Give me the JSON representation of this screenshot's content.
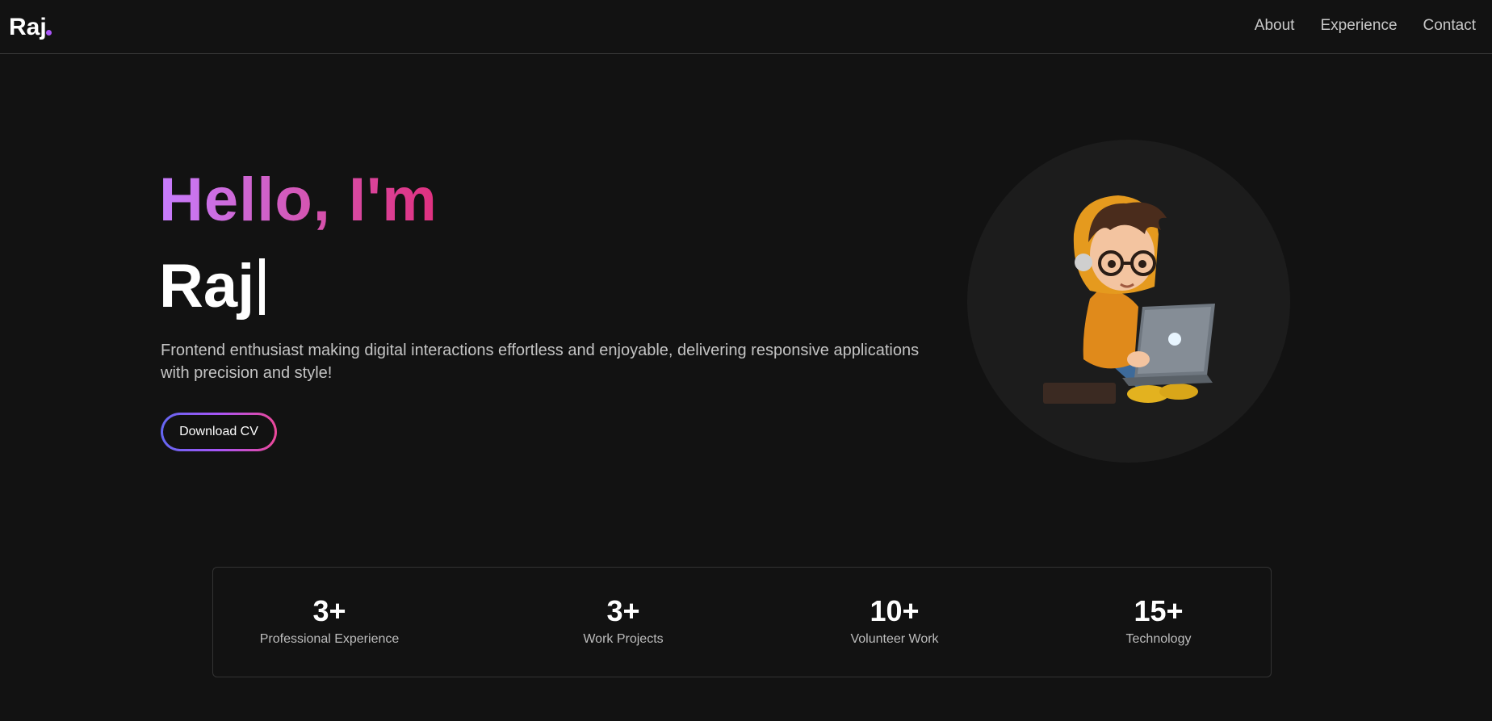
{
  "nav": {
    "logo": "Raj",
    "links": [
      "About",
      "Experience",
      "Contact"
    ]
  },
  "hero": {
    "greeting": "Hello, I'm",
    "name": "Raj",
    "tagline": "Frontend enthusiast making digital interactions effortless and enjoyable, delivering responsive applications with precision and style!",
    "cta_label": "Download CV"
  },
  "stats": [
    {
      "value": "3+",
      "label": "Professional Experience"
    },
    {
      "value": "3+",
      "label": "Work Projects"
    },
    {
      "value": "10+",
      "label": "Volunteer Work"
    },
    {
      "value": "15+",
      "label": "Technology"
    }
  ],
  "colors": {
    "background": "#121212",
    "accent_purple": "#a855f7",
    "accent_pink": "#ec4899"
  },
  "icons": {
    "avatar": "developer-avatar-illustration"
  }
}
